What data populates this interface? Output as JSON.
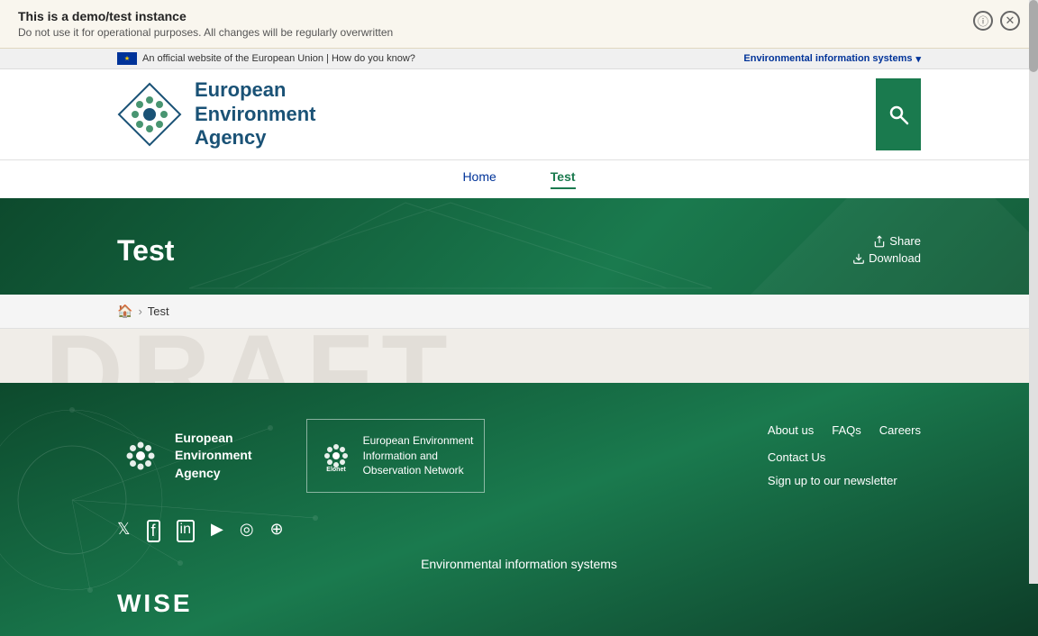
{
  "demo_banner": {
    "title": "This is a demo/test instance",
    "subtitle": "Do not use it for operational purposes. All changes will be regularly overwritten",
    "info_icon": "ⓘ",
    "close_icon": "✕"
  },
  "eu_bar": {
    "left_text": "An official website of the European Union | How do you know?",
    "right_text": "Environmental information systems",
    "chevron": "▾"
  },
  "header": {
    "logo_text_line1": "European",
    "logo_text_line2": "Environment",
    "logo_text_line3": "Agency",
    "search_label": "Search"
  },
  "nav": {
    "items": [
      {
        "label": "Home",
        "active": false
      },
      {
        "label": "Test",
        "active": true
      }
    ]
  },
  "page": {
    "title": "Test",
    "share_label": "Share",
    "download_label": "Download"
  },
  "breadcrumb": {
    "home": "🏠",
    "separator": "›",
    "current": "Test"
  },
  "footer": {
    "agency_name_line1": "European",
    "agency_name_line2": "Environment",
    "agency_name_line3": "Agency",
    "elonet_label": "Elonet",
    "elonet_desc_line1": "European Environment",
    "elonet_desc_line2": "Information and",
    "elonet_desc_line3": "Observation Network",
    "links": {
      "about_us": "About us",
      "faqs": "FAQs",
      "careers": "Careers",
      "contact": "Contact Us",
      "newsletter": "Sign up to our newsletter"
    },
    "social_icons": [
      "𝕏",
      "f",
      "in",
      "▶",
      "◉",
      "⊕"
    ],
    "env_systems": "Environmental information systems",
    "wise": "WISE"
  }
}
